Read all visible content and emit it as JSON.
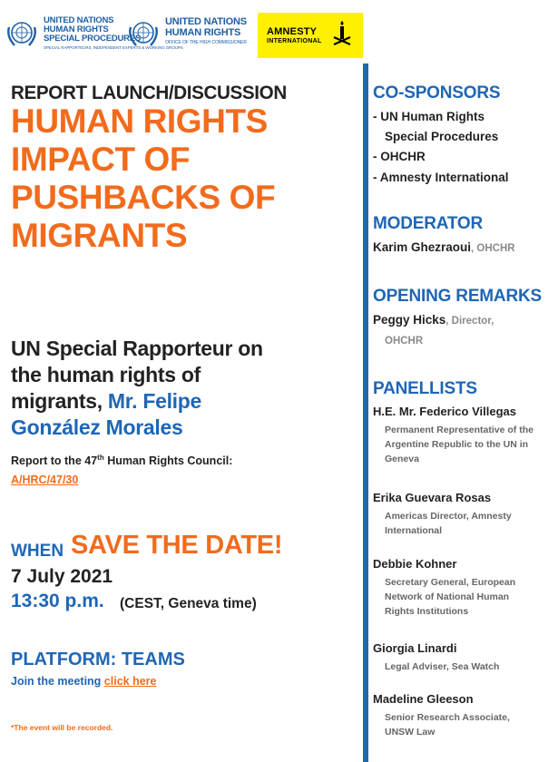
{
  "logos": {
    "un_sp": {
      "line1": "UNITED NATIONS",
      "line2": "HUMAN RIGHTS",
      "line3": "SPECIAL PROCEDURES",
      "sub": "SPECIAL RAPPORTEURS, INDEPENDENT EXPERTS & WORKING GROUPS"
    },
    "ohchr": {
      "line1": "UNITED NATIONS",
      "line2": "HUMAN RIGHTS",
      "sub": "OFFICE OF THE HIGH COMMISSIONER"
    },
    "amnesty": {
      "line1": "AMNESTY",
      "line2": "INTERNATIONAL"
    }
  },
  "event": {
    "kicker": "REPORT LAUNCH/DISCUSSION",
    "title_lines": [
      "HUMAN RIGHTS",
      "IMPACT OF",
      "PUSHBACKS OF",
      "MIGRANTS"
    ],
    "speaker_line1": "UN Special Rapporteur on",
    "speaker_line2": "the human rights of",
    "speaker_line3a": "migrants, ",
    "speaker_line3b": "Mr. Felipe",
    "speaker_line4": "González Morales",
    "report_to_a": "Report to the 47",
    "report_to_sup": "th",
    "report_to_b": " Human Rights Council:",
    "doc_link": "A/HRC/47/30",
    "when_label": "WHEN",
    "save_date": "SAVE THE DATE!",
    "date": "7 July 2021",
    "time": "13:30 p.m.",
    "timezone": "(CEST, Geneva time)",
    "platform": "PLATFORM: TEAMS",
    "join_text": "Join the meeting ",
    "join_link": "click here",
    "recorded_note": "*The event will be recorded."
  },
  "sidebar": {
    "cosponsors_heading": "CO-SPONSORS",
    "cosponsors": [
      "- UN Human Rights",
      "Special Procedures",
      "- OHCHR",
      "- Amnesty International"
    ],
    "moderator_heading": "MODERATOR",
    "moderator_name": "Karim Ghezraoui",
    "moderator_org": ", OHCHR",
    "opening_heading": "OPENING REMARKS",
    "opening_name": "Peggy Hicks",
    "opening_role": ", Director,",
    "opening_org": "OHCHR",
    "panellists_heading": "PANELLISTS",
    "panellists": [
      {
        "name": "H.E. Mr. Federico Villegas",
        "role": "Permanent Representative of the Argentine Republic to the UN in Geneva"
      },
      {
        "name": "Erika Guevara Rosas",
        "role": "Americas Director, Amnesty International"
      },
      {
        "name": "Debbie Kohner",
        "role": "Secretary General, European Network of National Human Rights Institutions"
      },
      {
        "name": "Giorgia Linardi",
        "role": "Legal Adviser, Sea Watch"
      },
      {
        "name": "Madeline Gleeson",
        "role": "Senior Research Associate, UNSW Law"
      }
    ]
  },
  "colors": {
    "orange": "#f26b1d",
    "blue": "#1f66b5",
    "amnesty_yellow": "#ffef00"
  }
}
